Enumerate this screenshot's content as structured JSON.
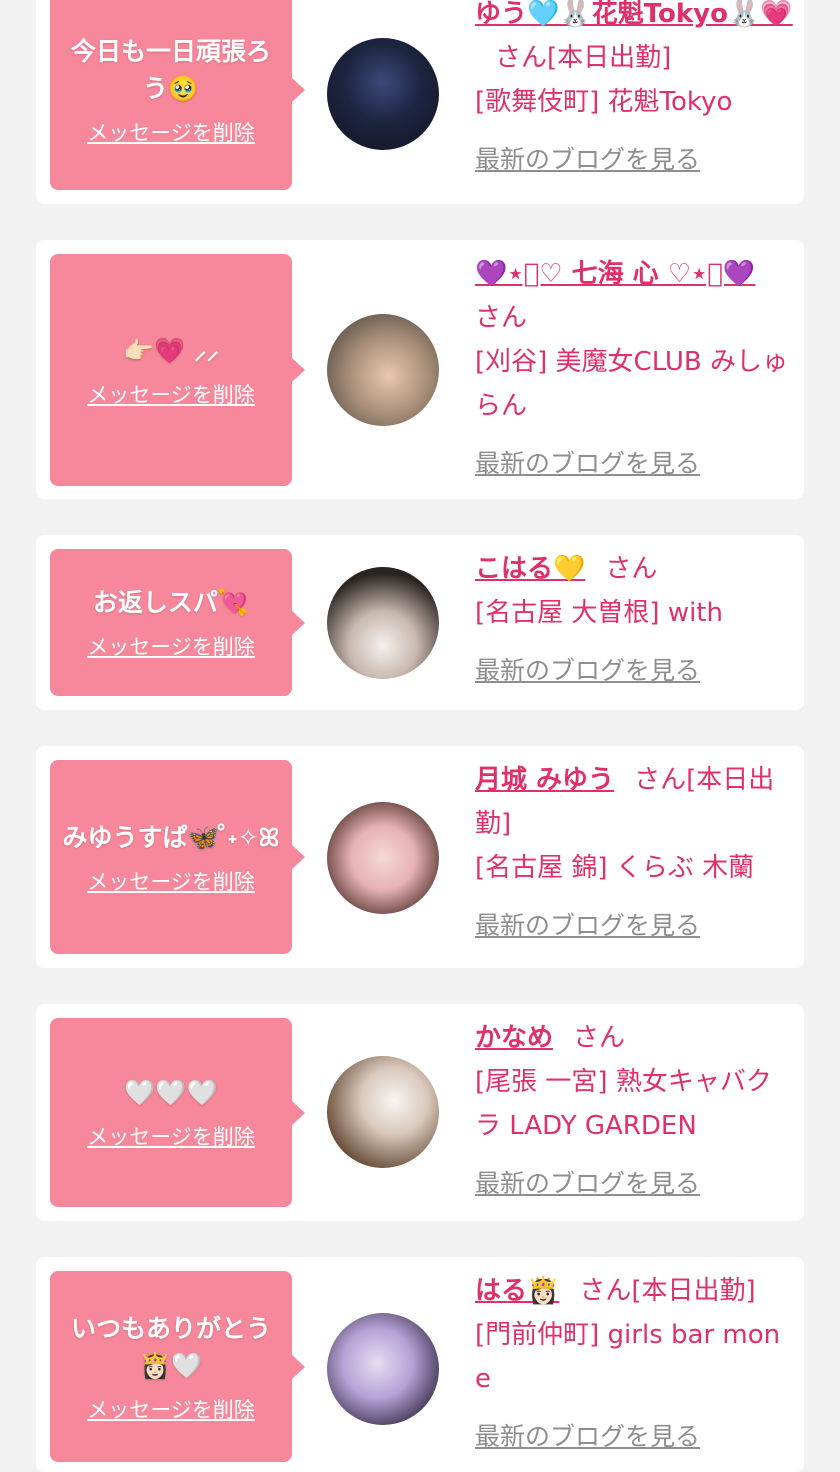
{
  "colors": {
    "page_bg": "#f2f2f2",
    "card_bg": "#ffffff",
    "bubble_bg": "#f7879a",
    "name_pink": "#e0306a",
    "link_gray": "#8e8e8e"
  },
  "items": [
    {
      "message": "今日も一日頑張ろう🥹",
      "delete_label": "メッセージを削除",
      "name": "ゆう🩵🐰花魁Tokyo🐰💗",
      "suffix": "さん",
      "status": "[本日出勤]",
      "shop": "[歌舞伎町] 花魁Tokyo",
      "blog_label": "最新のブログを見る",
      "avatar_icon": "avatar-photo"
    },
    {
      "message": "👉🏻💗 ⸝⸝",
      "delete_label": "メッセージを削除",
      "name": "💜⋆͛♡ 七海 心 ♡⋆͛💜",
      "suffix": "さん",
      "status": "",
      "shop": "[刈谷] 美魔女CLUB みしゅらん",
      "blog_label": "最新のブログを見る",
      "avatar_icon": "avatar-photo"
    },
    {
      "message": "お返しスパ💘",
      "delete_label": "メッセージを削除",
      "name": "こはる💛",
      "suffix": "さん",
      "status": "",
      "shop": "[名古屋 大曽根] with",
      "blog_label": "最新のブログを見る",
      "avatar_icon": "avatar-photo"
    },
    {
      "message": "みゆうすぱ🦋 ̊˖✧ꕤ",
      "delete_label": "メッセージを削除",
      "name": "月城 みゆう",
      "suffix": "さん",
      "status": "[本日出勤]",
      "shop": "[名古屋 錦] くらぶ 木蘭",
      "blog_label": "最新のブログを見る",
      "avatar_icon": "avatar-photo"
    },
    {
      "message": "🤍🤍🤍",
      "delete_label": "メッセージを削除",
      "name": "かなめ",
      "suffix": "さん",
      "status": "",
      "shop": "[尾張 一宮] 熟女キャバクラ LADY GARDEN",
      "blog_label": "最新のブログを見る",
      "avatar_icon": "avatar-photo"
    },
    {
      "message": "いつもありがとう👸🏻🤍",
      "delete_label": "メッセージを削除",
      "name": "はる👸🏻",
      "suffix": "さん",
      "status": "[本日出勤]",
      "shop": "[門前仲町] girls bar mone",
      "blog_label": "最新のブログを見る",
      "avatar_icon": "avatar-photo"
    }
  ]
}
